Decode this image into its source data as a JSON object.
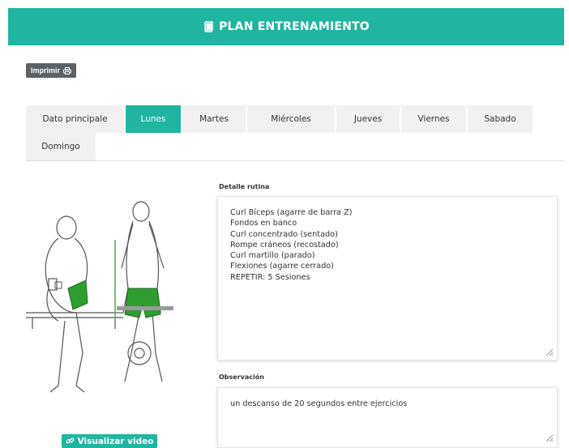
{
  "header": {
    "title": "PLAN ENTRENAMIENTO",
    "icon": "book-icon"
  },
  "print_button": {
    "label": "Imprimir",
    "icon": "printer-icon"
  },
  "tabs": [
    {
      "label": "Dato principale",
      "active": false
    },
    {
      "label": "Lunes",
      "active": true
    },
    {
      "label": "Martes",
      "active": false
    },
    {
      "label": "Miércoles",
      "active": false
    },
    {
      "label": "Jueves",
      "active": false
    },
    {
      "label": "Viernes",
      "active": false
    },
    {
      "label": "Sabado",
      "active": false
    },
    {
      "label": "Domingo",
      "active": false
    }
  ],
  "illustration": {
    "caption": "Exercise illustration",
    "watermark": ""
  },
  "video_button": {
    "label": "Visualizar video",
    "icon": "link-icon"
  },
  "detail": {
    "label": "Detalle rutina",
    "lines": [
      "Curl Bíceps (agarre de barra Z)",
      "Fondos en banco",
      "Curl concentrado (sentado)",
      "Rompe cráneos (recostado)",
      "Curl martillo (parado)",
      "Flexiones (agarre cerrado)",
      "REPETIR: 5 Sesiones"
    ]
  },
  "observation": {
    "label": "Observación",
    "text": "un descanso de 20 segundos entre ejercicios"
  },
  "colors": {
    "accent": "#20b5a0",
    "print_button": "#5a6168",
    "tab_bg": "#f1f1f1"
  }
}
